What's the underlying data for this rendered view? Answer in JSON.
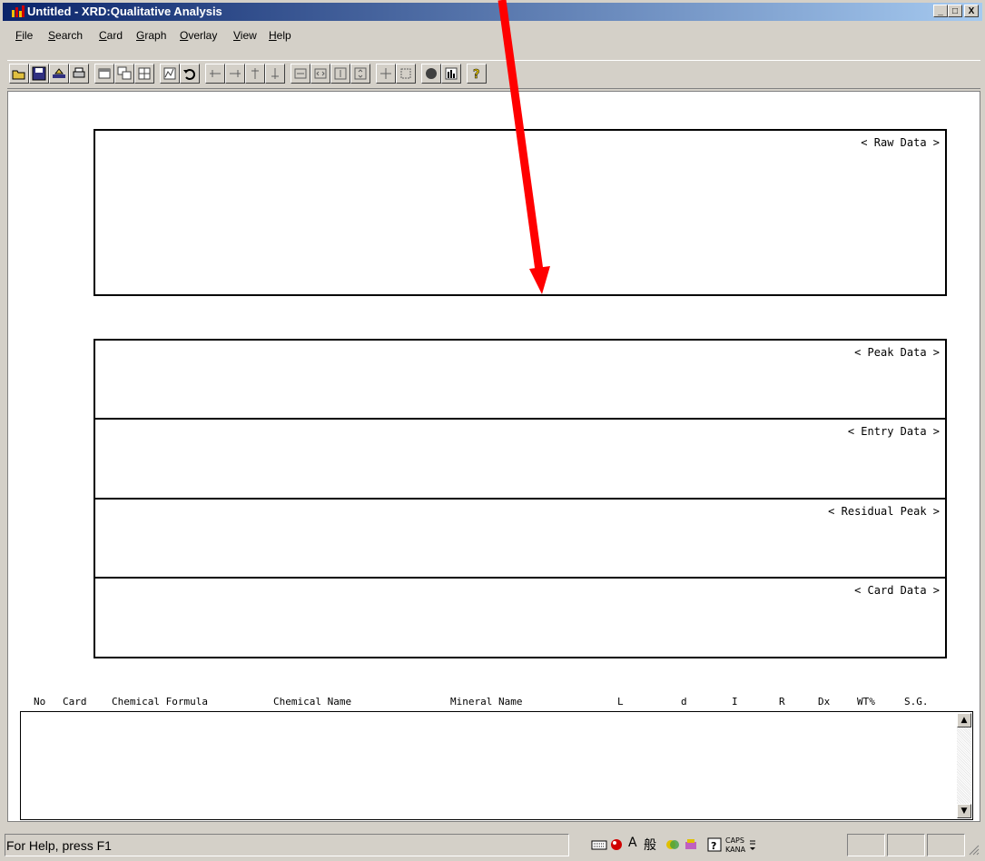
{
  "window": {
    "title": "Untitled - XRD:Qualitative Analysis",
    "min_btn": "_",
    "max_btn": "□",
    "close_btn": "X"
  },
  "menu": [
    "File",
    "Search",
    "Card",
    "Graph",
    "Overlay",
    "View",
    "Help"
  ],
  "toolbar_icons": [
    "open-icon",
    "save-icon",
    "import-icon",
    "print-icon",
    "window-icon",
    "copy-window-icon",
    "tile-icon",
    "graph-icon",
    "undo-icon",
    "peak-left-icon",
    "peak-right-icon",
    "peak-up-icon",
    "peak-down-icon",
    "expand-x-icon",
    "shrink-x-icon",
    "expand-y-icon",
    "shrink-y-icon",
    "move-icon",
    "fit-icon",
    "circle-icon",
    "bar-graph-icon",
    "help-icon"
  ],
  "panels": {
    "raw": "< Raw Data >",
    "peak": "< Peak Data >",
    "entry": "< Entry Data >",
    "residual": "< Residual Peak >",
    "card": "< Card Data >"
  },
  "columns": {
    "no": "No",
    "card": "Card",
    "formula": "Chemical Formula",
    "chemname": "Chemical Name",
    "mineral": "Mineral Name",
    "l": "L",
    "d": "d",
    "i": "I",
    "r": "R",
    "dx": "Dx",
    "wt": "WT%",
    "sg": "S.G."
  },
  "status": {
    "help": "For Help, press F1",
    "ime_a": "A",
    "ime_han": "般",
    "caps": "CAPS",
    "kana": "KANA"
  },
  "colors": {
    "arrow": "#ff0000",
    "title_start": "#0a246a",
    "title_end": "#a6caf0"
  }
}
